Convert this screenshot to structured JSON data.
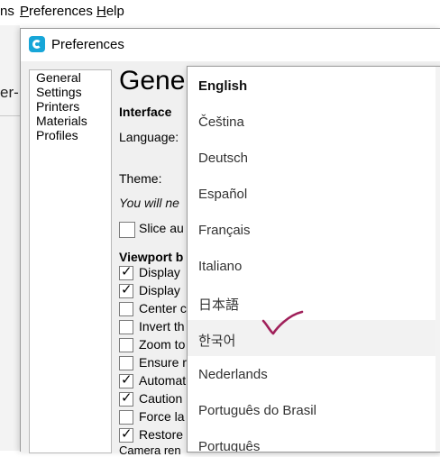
{
  "menubar": {
    "items": [
      {
        "label_before": "ns "
      },
      {
        "label_u": "P",
        "label_rest": "references"
      },
      {
        "label_u": "H",
        "label_rest": "elp"
      }
    ]
  },
  "background": {
    "tab_text": "er-"
  },
  "window": {
    "title": "Preferences"
  },
  "nav": {
    "items": [
      "General",
      "Settings",
      "Printers",
      "Materials",
      "Profiles"
    ]
  },
  "content": {
    "title": "Gene",
    "interface_heading": "Interface",
    "language_label": "Language:",
    "theme_label": "Theme:",
    "restart_note": "You will ne",
    "slice_label": "Slice au",
    "viewport_heading": "Viewport b",
    "checkboxes": [
      {
        "label": "Display",
        "checked": true
      },
      {
        "label": "Display",
        "checked": true
      },
      {
        "label": "Center c",
        "checked": false
      },
      {
        "label": "Invert th",
        "checked": false
      },
      {
        "label": "Zoom to",
        "checked": false
      },
      {
        "label": "Ensure r",
        "checked": false
      },
      {
        "label": "Automat",
        "checked": true
      },
      {
        "label": "Caution",
        "checked": true
      },
      {
        "label": "Force la",
        "checked": false
      },
      {
        "label": "Restore",
        "checked": true
      }
    ],
    "cut_text": "Camera ren"
  },
  "dropdown": {
    "selected": "English",
    "hovered": "한국어",
    "options": [
      "English",
      "Čeština",
      "Deutsch",
      "Español",
      "Français",
      "Italiano",
      "日本語",
      "한국어",
      "Nederlands",
      "Português do Brasil",
      "Português"
    ]
  },
  "annotation": {
    "icon": "handwritten-checkmark",
    "color": "#a0205a"
  }
}
